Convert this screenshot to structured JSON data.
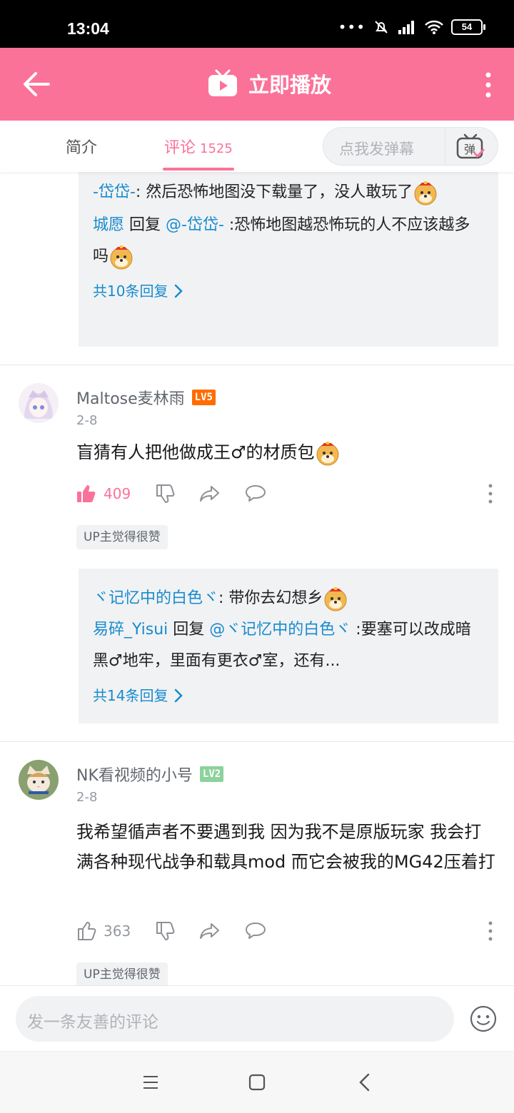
{
  "status_bar": {
    "time": "13:04",
    "battery": "54"
  },
  "top_bar": {
    "title": "立即播放"
  },
  "tabs": {
    "intro": "简介",
    "comments": "评论",
    "comment_count": "1525",
    "danmaku_placeholder": "点我发弹幕",
    "danmaku_icon_label": "弹"
  },
  "thread1": {
    "reply1_user": "-岱岱-",
    "reply1_text": ": 然后恐怖地图没下载量了，没人敢玩了",
    "reply2_user": "城愿",
    "reply2_mid": " 回复 ",
    "reply2_mention": "@-岱岱-",
    "reply2_text": " :恐怖地图越恐怖玩的人不应该越多吗",
    "more": "共10条回复"
  },
  "comment1": {
    "user": "Maltose麦林雨",
    "level": "LV5",
    "level_color": "#ff6c00",
    "date": "2-8",
    "text": "盲猜有人把他做成王♂的材质包",
    "likes": "409",
    "liked": true,
    "badge": "UP主觉得很赞",
    "reply1_user": "ヾ记忆中的白色ヾ",
    "reply1_text": ": 带你去幻想乡",
    "reply2_user": "易碎_Yisui",
    "reply2_mid": " 回复 ",
    "reply2_mention": "@ヾ记忆中的白色ヾ",
    "reply2_text": " :要塞可以改成暗黑♂地牢，里面有更衣♂室，还有...",
    "more": "共14条回复"
  },
  "comment2": {
    "user": "NK看视频的小号",
    "level": "LV2",
    "level_color": "#8bd29b",
    "date": "2-8",
    "text": "我希望循声者不要遇到我 因为我不是原版玩家 我会打满各种现代战争和载具mod 而它会被我的MG42压着打",
    "likes": "363",
    "liked": false,
    "badge": "UP主觉得很赞"
  },
  "bottom": {
    "input_placeholder": "发一条友善的评论"
  },
  "colors": {
    "accent": "#fb7299",
    "link": "#178bcf"
  }
}
